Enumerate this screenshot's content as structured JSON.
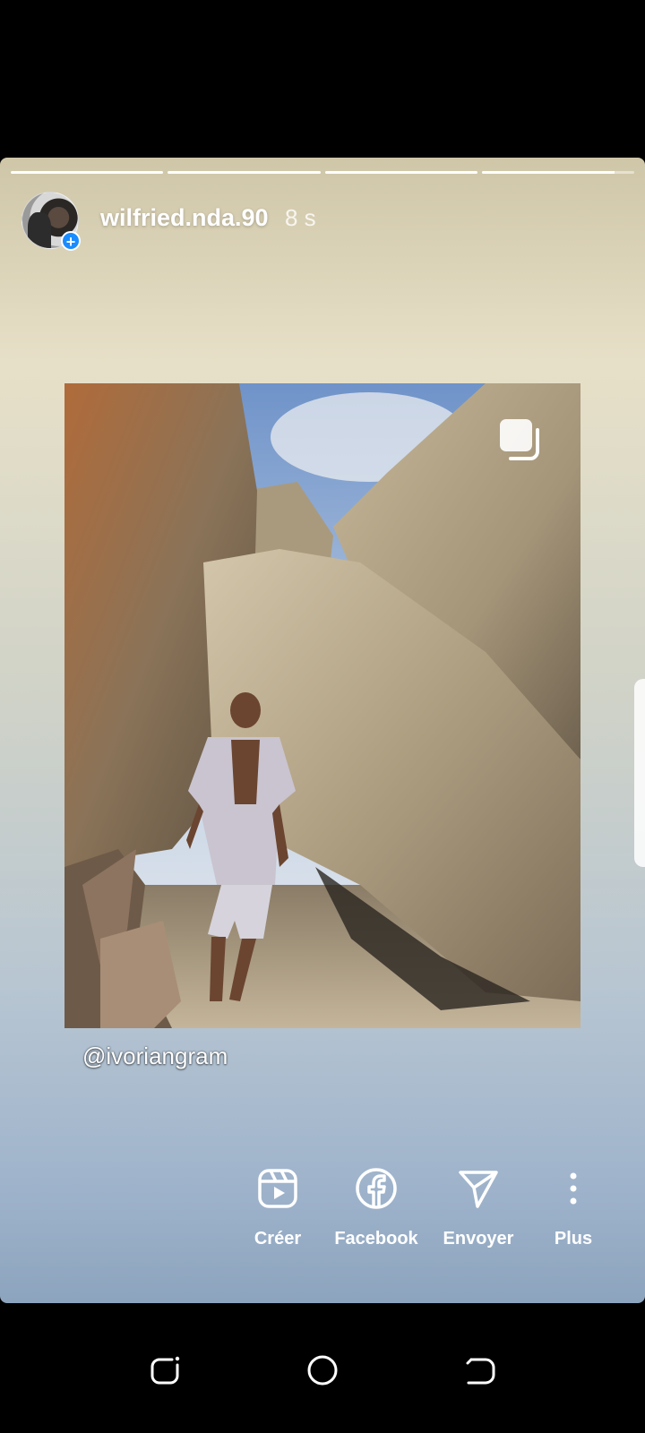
{
  "story": {
    "progress": [
      1,
      1,
      1,
      0.87
    ],
    "username": "wilfried.nda.90",
    "timestamp": "8 s",
    "mention": "@ivoriangram"
  },
  "actions": [
    {
      "label": "Créer",
      "icon": "reels-icon"
    },
    {
      "label": "Facebook",
      "icon": "facebook-icon"
    },
    {
      "label": "Envoyer",
      "icon": "send-icon"
    },
    {
      "label": "Plus",
      "icon": "more-vertical-icon"
    }
  ],
  "navbar": {
    "icons": [
      "recent-apps-icon",
      "home-icon",
      "back-icon"
    ]
  },
  "colors": {
    "badge_blue": "#1a8cff",
    "bar_white": "#ffffff"
  }
}
